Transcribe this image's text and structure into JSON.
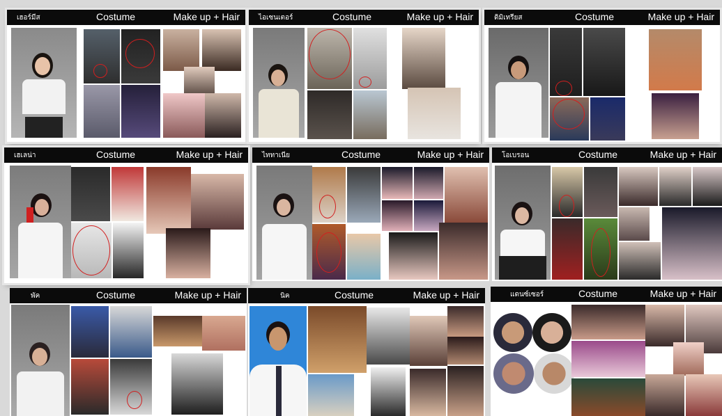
{
  "boards": [
    {
      "name": "เฮอร์มีส",
      "costume": "Costume",
      "makeup": "Make up + Hair"
    },
    {
      "name": "ไอเซนเตอร์",
      "costume": "Costume",
      "makeup": "Make up + Hair"
    },
    {
      "name": "ดิมิเทรียส",
      "costume": "Costume",
      "makeup": "Make up + Hair"
    },
    {
      "name": "เฮเลน่า",
      "costume": "Costume",
      "makeup": "Make up + Hair"
    },
    {
      "name": "ไททาเนีย",
      "costume": "Costume",
      "makeup": "Make up + Hair"
    },
    {
      "name": "โอเบรอน",
      "costume": "Costume",
      "makeup": "Make up + Hair"
    },
    {
      "name": "พัค",
      "costume": "Costume",
      "makeup": "Make up + Hair"
    },
    {
      "name": "นิค",
      "costume": "Costume",
      "makeup": "Make up + Hair"
    },
    {
      "name": "แดนซ์เซอร์",
      "costume": "Costume",
      "makeup": "Make up + Hair"
    }
  ]
}
